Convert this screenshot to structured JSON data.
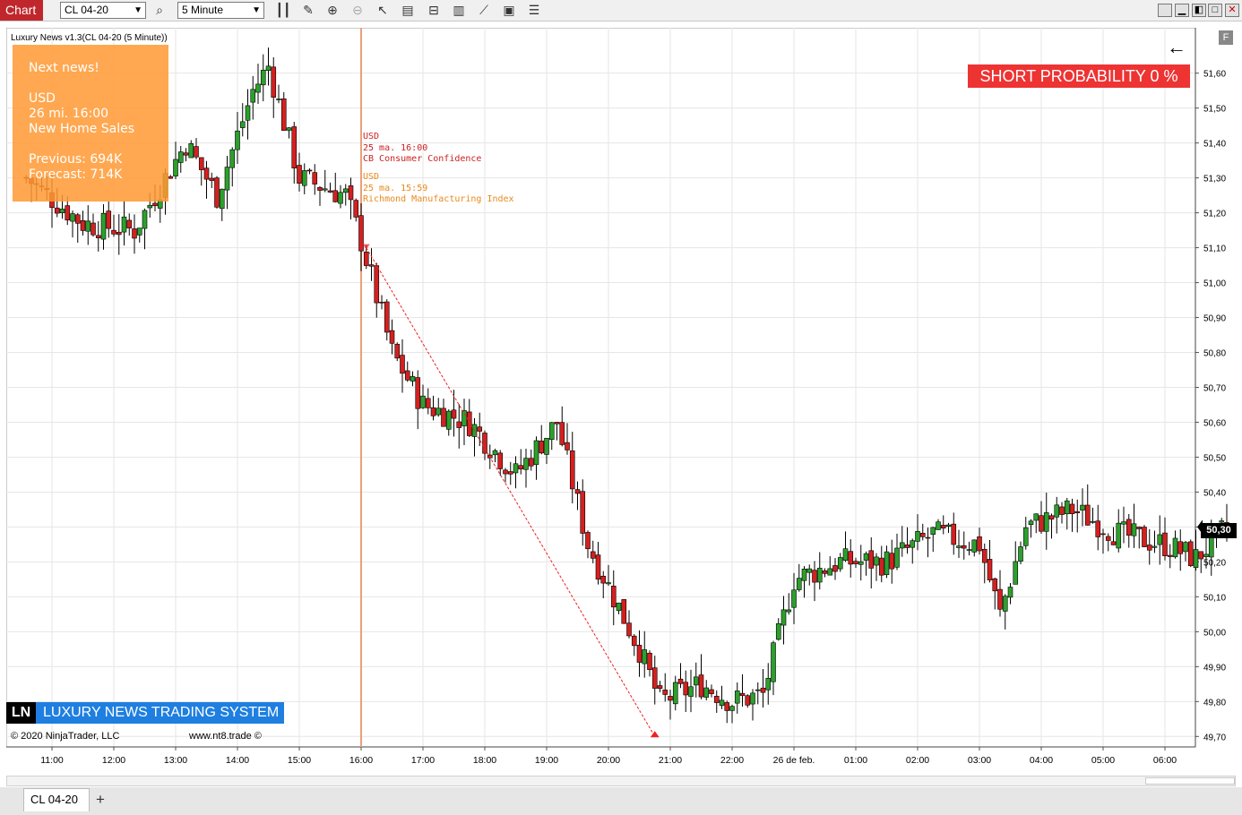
{
  "toolbar": {
    "app_title": "Chart",
    "instrument": "CL 04-20",
    "interval": "5 Minute",
    "icons": [
      "search-icon",
      "bar-style-icon",
      "draw-pencil-icon",
      "zoom-in-icon",
      "zoom-out-icon",
      "pointer-icon",
      "data-box-icon",
      "chart-trader-icon",
      "indicators-icon",
      "strategies-icon",
      "properties-icon",
      "templates-icon"
    ]
  },
  "chart": {
    "indicator_label": "Luxury News v1.3(CL 04-20 (5 Minute))",
    "news_box": {
      "heading": "Next news!",
      "currency": "USD",
      "datetime": "26 mi. 16:00",
      "event": "New Home Sales",
      "previous": "Previous: 694K",
      "forecast": "Forecast: 714K"
    },
    "short_probability": "SHORT PROBABILITY 0 %",
    "events": [
      {
        "currency": "USD",
        "datetime": "25 ma. 16:00",
        "name": "CB Consumer Confidence",
        "color": "#cc2222"
      },
      {
        "currency": "USD",
        "datetime": "25 ma. 15:59",
        "name": "Richmond Manufacturing Index",
        "color": "#e8891c"
      }
    ],
    "banner_mark": "LN",
    "banner_text": "LUXURY NEWS TRADING SYSTEM",
    "copyright": "© 2020 NinjaTrader, LLC",
    "website": "www.nt8.trade ©",
    "last_price": "50,30",
    "f_button": "F",
    "colors": {
      "up": "#2ca02c",
      "down": "#d42020",
      "event_line": "#e8a07a",
      "trend_line": "#ee2222"
    }
  },
  "chart_data": {
    "type": "candlestick",
    "y_tick_labels": [
      "51,60",
      "51,50",
      "51,40",
      "51,30",
      "51,20",
      "51,10",
      "51,00",
      "50,90",
      "50,80",
      "50,70",
      "50,60",
      "50,50",
      "50,40",
      "50,30",
      "50,20",
      "50,10",
      "50,00",
      "49,90",
      "49,80",
      "49,70"
    ],
    "ylim": [
      49.67,
      51.73
    ],
    "x_tick_labels": [
      "11:00",
      "12:00",
      "13:00",
      "14:00",
      "15:00",
      "16:00",
      "17:00",
      "18:00",
      "19:00",
      "20:00",
      "21:00",
      "22:00",
      "26 de feb.",
      "01:00",
      "02:00",
      "03:00",
      "04:00",
      "05:00",
      "06:00"
    ],
    "grid": true,
    "approx_close_path": [
      {
        "time": "10:35",
        "price": 51.3
      },
      {
        "time": "11:30",
        "price": 51.17
      },
      {
        "time": "12:20",
        "price": 51.15
      },
      {
        "time": "13:10",
        "price": 51.4
      },
      {
        "time": "13:40",
        "price": 51.25
      },
      {
        "time": "14:15",
        "price": 51.55
      },
      {
        "time": "14:30",
        "price": 51.62
      },
      {
        "time": "15:00",
        "price": 51.3
      },
      {
        "time": "15:45",
        "price": 51.25
      },
      {
        "time": "16:00",
        "price": 51.12
      },
      {
        "time": "16:30",
        "price": 50.8
      },
      {
        "time": "17:00",
        "price": 50.65
      },
      {
        "time": "17:45",
        "price": 50.6
      },
      {
        "time": "18:30",
        "price": 50.45
      },
      {
        "time": "19:10",
        "price": 50.6
      },
      {
        "time": "19:40",
        "price": 50.25
      },
      {
        "time": "20:30",
        "price": 49.95
      },
      {
        "time": "20:50",
        "price": 49.8
      },
      {
        "time": "21:30",
        "price": 49.85
      },
      {
        "time": "22:00",
        "price": 49.8
      },
      {
        "time": "22:30",
        "price": 49.82
      },
      {
        "time": "23:00",
        "price": 50.15
      },
      {
        "time": "23:45",
        "price": 50.2
      },
      {
        "time": "00:30",
        "price": 50.2
      },
      {
        "time": "01:15",
        "price": 50.28
      },
      {
        "time": "02:00",
        "price": 50.25
      },
      {
        "time": "02:20",
        "price": 50.05
      },
      {
        "time": "02:45",
        "price": 50.3
      },
      {
        "time": "03:30",
        "price": 50.35
      },
      {
        "time": "04:15",
        "price": 50.28
      },
      {
        "time": "05:00",
        "price": 50.25
      },
      {
        "time": "05:30",
        "price": 50.21
      },
      {
        "time": "06:00",
        "price": 50.3
      }
    ],
    "event_time": "16:00",
    "trend_line": {
      "from": {
        "time": "16:05",
        "price": 51.1
      },
      "to": {
        "time": "20:45",
        "price": 49.7
      }
    }
  },
  "tabs": {
    "active": "CL 04-20",
    "add": "+"
  }
}
